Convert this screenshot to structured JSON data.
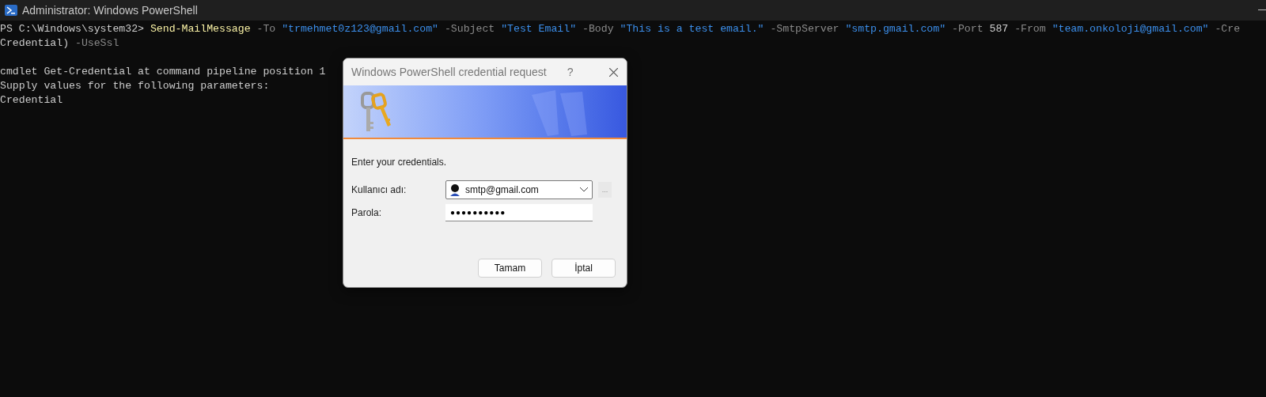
{
  "window": {
    "title": "Administrator: Windows PowerShell"
  },
  "console": {
    "lines": [
      {
        "spans": [
          {
            "kind": "plain",
            "text": "PS C:\\Windows\\system32> "
          },
          {
            "kind": "command",
            "text": "Send-MailMessage"
          },
          {
            "kind": "param",
            "text": " -To "
          },
          {
            "kind": "string",
            "text": "\"trmehmet0z123@gmail.com\""
          },
          {
            "kind": "param",
            "text": " -Subject "
          },
          {
            "kind": "string",
            "text": "\"Test Email\""
          },
          {
            "kind": "param",
            "text": " -Body "
          },
          {
            "kind": "string",
            "text": "\"This is a test email.\""
          },
          {
            "kind": "param",
            "text": " -SmtpServer "
          },
          {
            "kind": "string",
            "text": "\"smtp.gmail.com\""
          },
          {
            "kind": "param",
            "text": " -Port "
          },
          {
            "kind": "plain",
            "text": "587"
          },
          {
            "kind": "param",
            "text": " -From "
          },
          {
            "kind": "string",
            "text": "\"team.onkoloji@gmail.com\""
          },
          {
            "kind": "param",
            "text": " -Cre"
          }
        ]
      },
      {
        "spans": [
          {
            "kind": "plain",
            "text": "Credential) "
          },
          {
            "kind": "param",
            "text": "-UseSsl"
          }
        ]
      },
      {
        "blank_before": true,
        "spans": [
          {
            "kind": "plain",
            "text": "cmdlet Get-Credential at command pipeline position 1"
          }
        ]
      },
      {
        "spans": [
          {
            "kind": "plain",
            "text": "Supply values for the following parameters:"
          }
        ]
      },
      {
        "spans": [
          {
            "kind": "plain",
            "text": "Credential"
          }
        ]
      }
    ]
  },
  "dialog": {
    "title": "Windows PowerShell credential request",
    "help": "?",
    "message": "Enter your credentials.",
    "fields": [
      {
        "kind": "combo",
        "label": "Kullanıcı adı:",
        "value": "smtp@gmail.com"
      },
      {
        "kind": "password",
        "label": "Parola:",
        "value": "●●●●●●●●●●"
      }
    ],
    "browse_button": "...",
    "buttons": [
      "Tamam",
      "İptal"
    ]
  }
}
